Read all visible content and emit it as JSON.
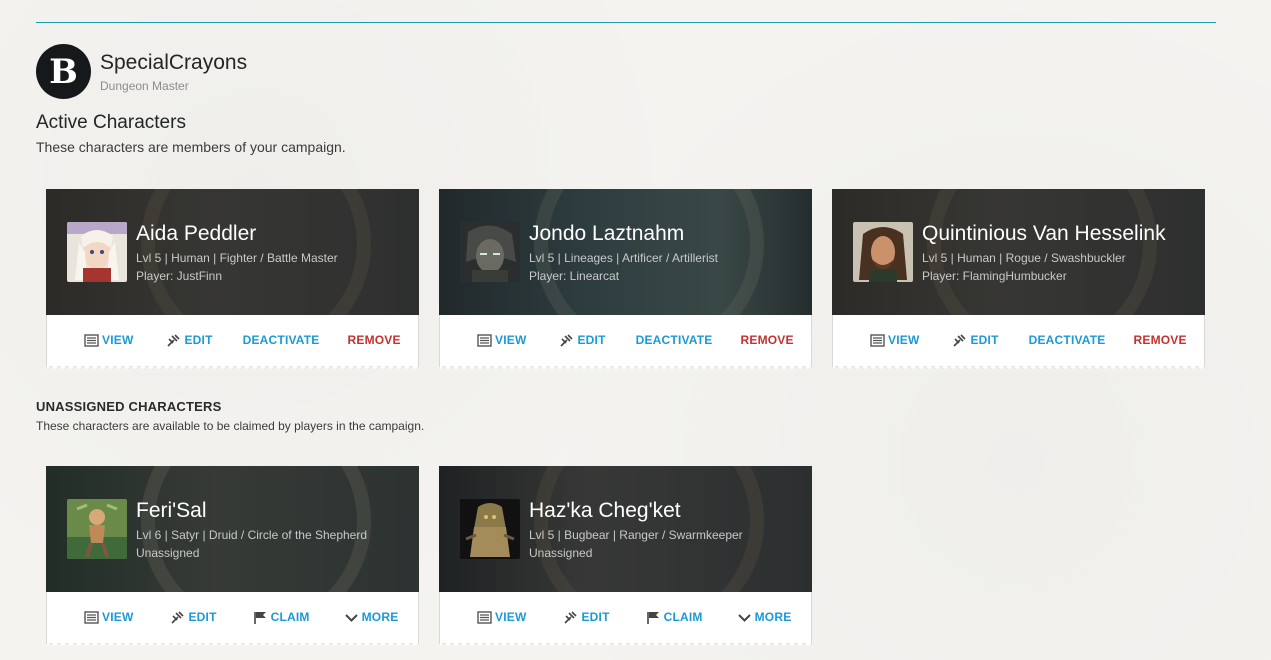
{
  "user": {
    "avatar_letter": "B",
    "name": "SpecialCrayons",
    "role": "Dungeon Master"
  },
  "active_section": {
    "title": "Active Characters",
    "description": "These characters are members of your campaign."
  },
  "unassigned_section": {
    "title": "UNASSIGNED CHARACTERS",
    "description": "These characters are available to be claimed by players in the campaign."
  },
  "actions": {
    "view": "VIEW",
    "edit": "EDIT",
    "deactivate": "DEACTIVATE",
    "remove": "REMOVE",
    "claim": "CLAIM",
    "more": "MORE"
  },
  "active_characters": [
    {
      "name": "Aida Peddler",
      "meta": "Lvl 5 | Human | Fighter / Battle Master",
      "player": "Player: JustFinn"
    },
    {
      "name": "Jondo Laztnahm",
      "meta": "Lvl 5 | Lineages | Artificer / Artillerist",
      "player": "Player: Linearcat"
    },
    {
      "name": "Quintinious Van Hesselink",
      "meta": "Lvl 5 | Human | Rogue / Swashbuckler",
      "player": "Player: FlamingHumbucker"
    }
  ],
  "unassigned_characters": [
    {
      "name": "Feri'Sal",
      "meta": "Lvl 6 | Satyr | Druid / Circle of the Shepherd",
      "player": "Unassigned"
    },
    {
      "name": "Haz'ka Cheg'ket",
      "meta": "Lvl 5 | Bugbear | Ranger / Swarmkeeper",
      "player": "Unassigned"
    }
  ],
  "colors": {
    "accent": "#1b9ad7",
    "rule": "#1b9ab1",
    "remove": "#c53131"
  }
}
